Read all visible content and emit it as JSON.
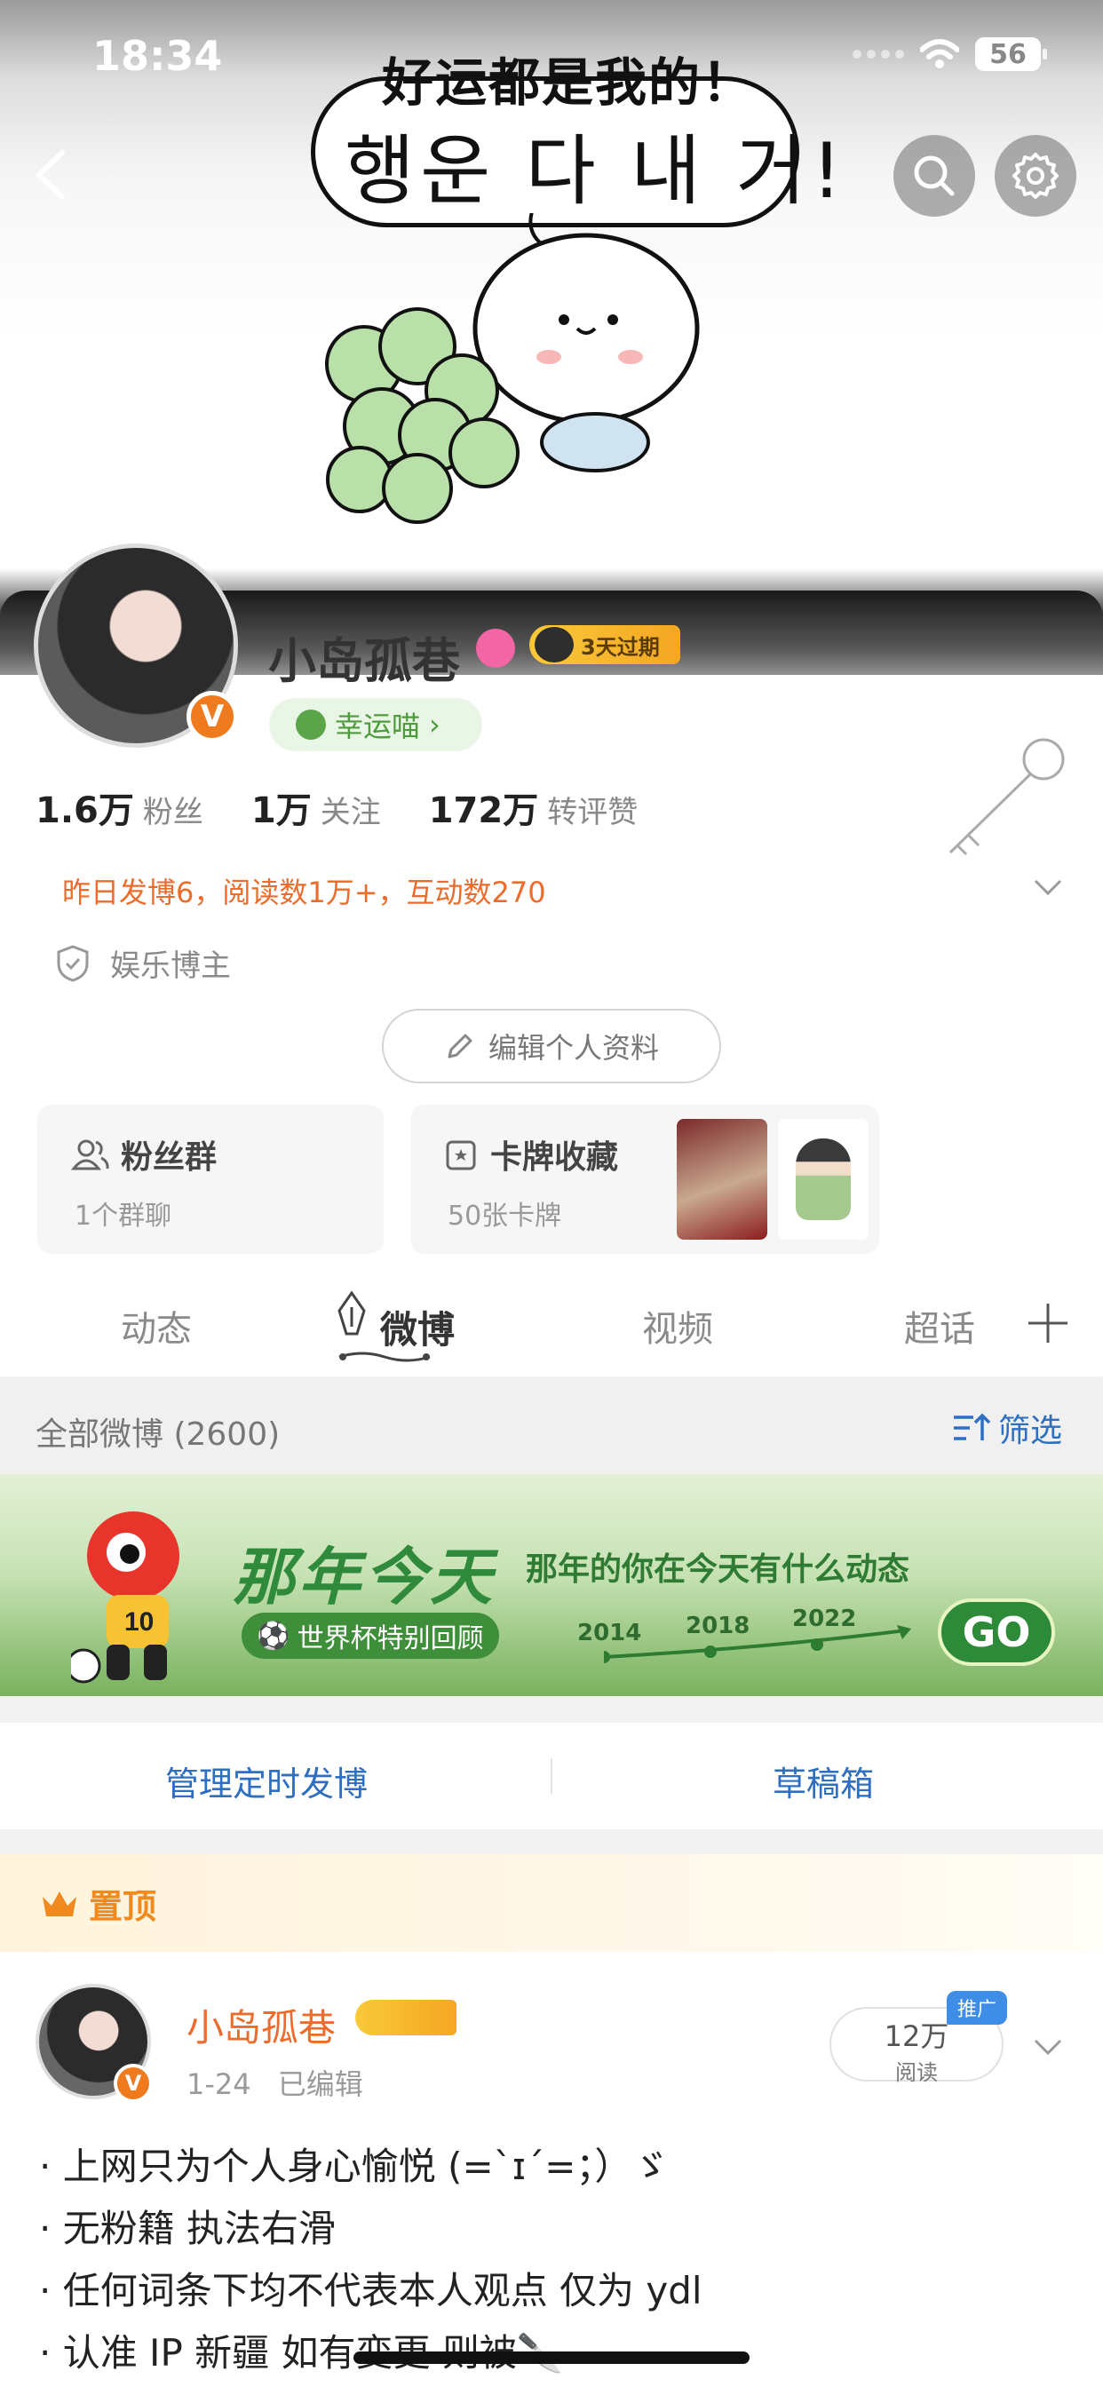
{
  "status_bar": {
    "time": "18:34",
    "battery": "56"
  },
  "cover": {
    "bubble_line1": "好运都是我的！",
    "bubble_line2": "행운 다 내 거!"
  },
  "profile": {
    "username": "小岛孤巷",
    "vip_label": "3天过期",
    "lucky_label": "幸运喵",
    "stats": [
      {
        "num": "1.6万",
        "label": "粉丝"
      },
      {
        "num": "1万",
        "label": "关注"
      },
      {
        "num": "172万",
        "label": "转评赞"
      }
    ],
    "activity": "昨日发博6，阅读数1万+，互动数270",
    "category": "娱乐博主",
    "edit_label": "编辑个人资料",
    "fan_group": {
      "title": "粉丝群",
      "sub": "1个群聊"
    },
    "card_collection": {
      "title": "卡牌收藏",
      "sub": "50张卡牌"
    }
  },
  "tabs": [
    {
      "label": "动态"
    },
    {
      "label": "微博"
    },
    {
      "label": "视频"
    },
    {
      "label": "超话"
    }
  ],
  "section": {
    "title": "全部微博 (2600)",
    "filter_label": "筛选"
  },
  "banner": {
    "title": "那年今天",
    "subtitle": "那年的你在今天有什么动态",
    "pill": "世界杯特别回顾",
    "years": [
      "2014",
      "2018",
      "2022"
    ],
    "go": "GO"
  },
  "manage": {
    "scheduled": "管理定时发博",
    "drafts": "草稿箱"
  },
  "pinned": {
    "label": "置顶",
    "post": {
      "name": "小岛孤巷",
      "meta": "1-24 已编辑",
      "reads_num": "12万",
      "reads_label": "阅读",
      "promo": "推广",
      "lines": [
        "· 上网只为个人身心愉悦 (=`ɪ´=；）ゞ",
        "· 无粉籍 执法右滑",
        "· 任何词条下均不代表本人观点 仅为 ydl",
        "· 认准 IP 新疆 如有变更 则被🔪"
      ]
    }
  },
  "colors": {
    "accent": "#eb6c2c",
    "link": "#2e6fc2",
    "banner_green": "#2f8a3b"
  }
}
